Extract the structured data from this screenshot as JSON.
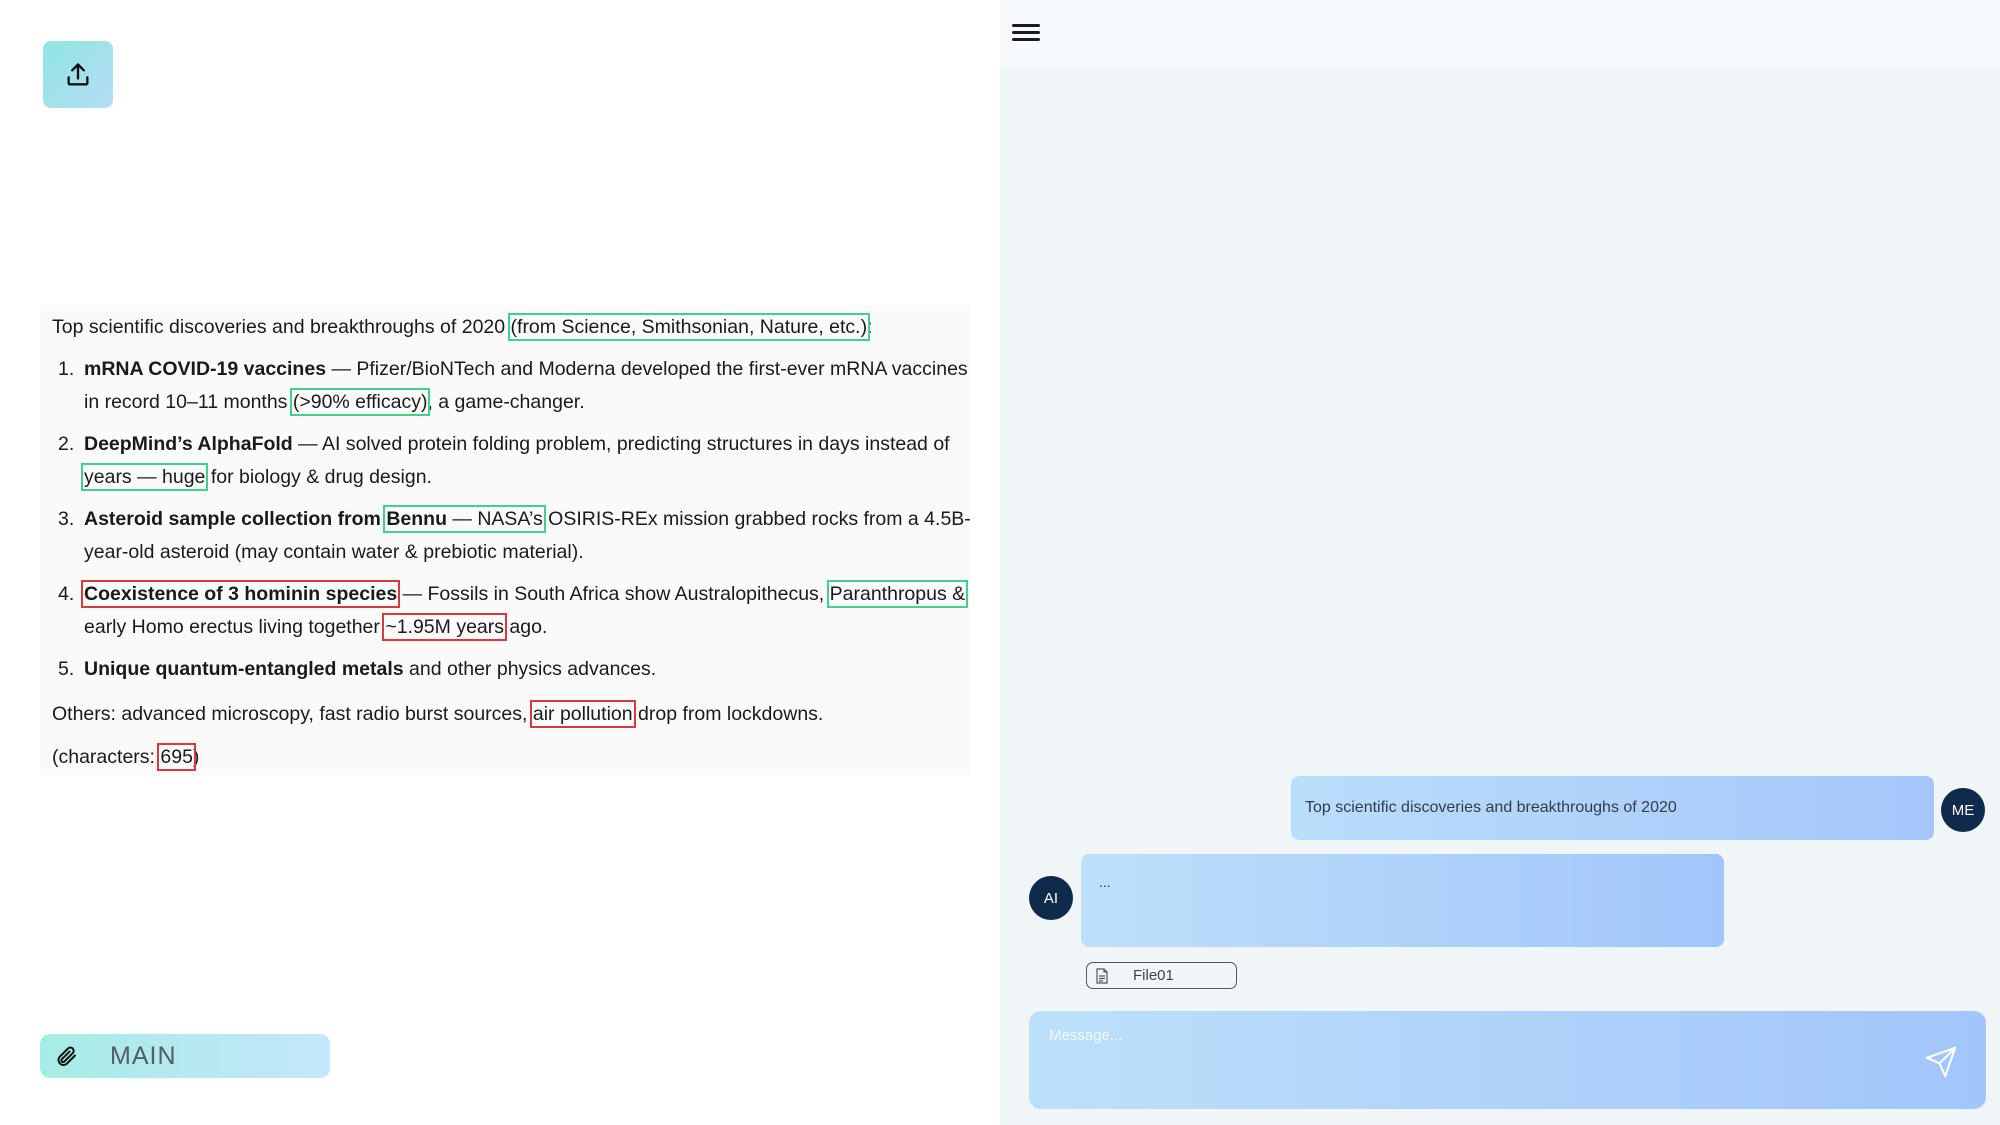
{
  "left": {
    "intro": "Top scientific discoveries and breakthroughs of 2020",
    "intro_sources": "(from Science, Smithsonian, Nature, etc.)",
    "intro_colon": ":",
    "items": [
      {
        "num": "1.",
        "title": "mRNA COVID-19 vaccines",
        "text_a": " — Pfizer/BioNTech and Moderna developed the first-ever mRNA vaccines in record 10–11 months ",
        "highlight": "(>90% efficacy)",
        "text_b": ", a game-changer."
      },
      {
        "num": "2.",
        "title": "DeepMind’s AlphaFold",
        "text_a": " — AI solved protein folding problem, predicting structures in days instead of ",
        "highlight": "years — huge",
        "text_b": " for biology & drug design."
      },
      {
        "num": "3.",
        "title": "Asteroid sample collection from ",
        "title_highlight": "Bennu",
        "highlight_rest": " — NASA’s",
        "text_b": " OSIRIS-REx mission grabbed rocks from a 4.5B-year-old asteroid (may contain water & prebiotic material)."
      },
      {
        "num": "4.",
        "title": "Coexistence of 3 hominin species",
        "text_a": " — Fossils in South Africa show Australopithecus, ",
        "highlight": "Paranthropus &",
        "text_b": " early Homo erectus living together ",
        "highlight_red": "~1.95M years",
        "text_c": " ago."
      },
      {
        "num": "5.",
        "title": "Unique quantum-entangled metals",
        "text_a": " and other physics advances."
      }
    ],
    "others_a": "Others: advanced microscopy, fast radio burst sources, ",
    "others_highlight": "air pollution",
    "others_b": " drop from lockdowns.",
    "chars_a": "(characters: ",
    "chars_value": "695",
    "chars_b": ")",
    "main_label": "MAIN"
  },
  "chat": {
    "me_avatar": "ME",
    "me_message": "Top scientific discoveries and breakthroughs of 2020",
    "ai_avatar": "AI",
    "ai_message": "...",
    "file_name": "File01",
    "composer_placeholder": "Message..."
  },
  "colors": {
    "highlight_green": "#3fd28a",
    "highlight_red": "#d63a3a",
    "avatar": "#0f2a4a"
  }
}
